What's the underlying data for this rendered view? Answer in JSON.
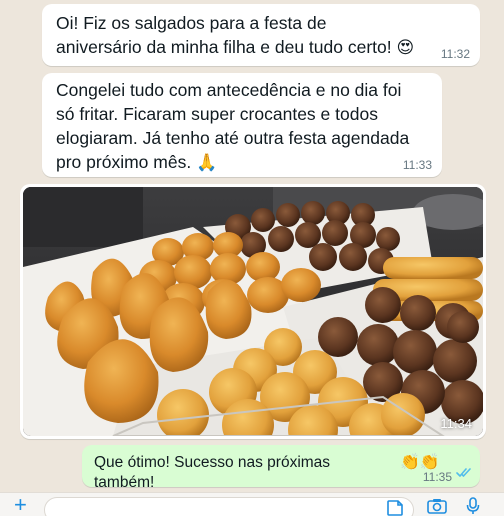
{
  "messages": [
    {
      "direction": "in",
      "text": "Oi! Fiz os salgados para a festa de\naniversário da minha filha e deu tudo certo! ",
      "emoji": "😍",
      "time": "11:32"
    },
    {
      "direction": "in",
      "text": "Congelei tudo com antecedência e no dia foi\nsó fritar. Ficaram super crocantes e todos\nelogiaram. Já tenho até outra festa agendada\npro próximo mês. ",
      "emoji": "🙏",
      "time": "11:33"
    },
    {
      "direction": "in",
      "type": "photo",
      "photo_subject": "trays of fried coxinhas, cheese balls and dark croquettes",
      "time": "11:34"
    },
    {
      "direction": "out",
      "text": "Que ótimo! Sucesso nas próximas também!",
      "emoji": "👏👏",
      "time": "11:35",
      "status": "read"
    }
  ],
  "composer": {
    "plus_icon": "plus-icon",
    "plus_glyph": "+",
    "placeholder": "",
    "icons": [
      "sticker-icon",
      "camera-icon",
      "mic-icon"
    ],
    "accent_color": "#1f8ee0"
  },
  "colors": {
    "chat_background": "#ede6dc",
    "incoming_bubble": "#ffffff",
    "outgoing_bubble": "#d9fdd3",
    "read_ticks": "#53bdeb"
  }
}
